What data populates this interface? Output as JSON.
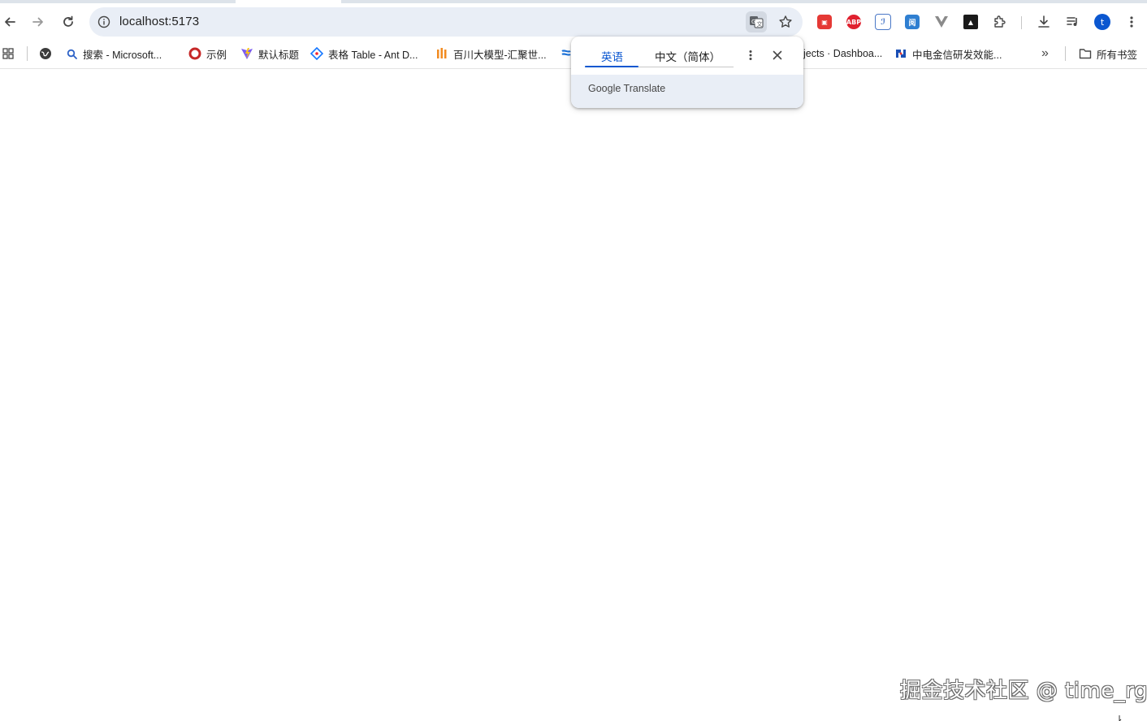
{
  "toolbar": {
    "url": "localhost:5173",
    "extensions": [
      "gift-extension",
      "adblock-plus-extension",
      "dictionary-extension",
      "translate-helper-extension",
      "vue-devtools-extension",
      "dark-extension",
      "extensions-puzzle"
    ],
    "abp_label": "ABP",
    "avatar_letter": "t"
  },
  "bookmarks": {
    "items": [
      {
        "label": "搜索 - Microsoft..."
      },
      {
        "label": "示例"
      },
      {
        "label": "默认标题"
      },
      {
        "label": "表格 Table - Ant D..."
      },
      {
        "label": "百川大模型-汇聚世..."
      },
      {
        "label": "jects · Dashboa..."
      },
      {
        "label": "中电金信研发效能..."
      }
    ],
    "overflow_label": "»",
    "all_bookmarks": "所有书签"
  },
  "translate_popup": {
    "tab_source": "英语",
    "tab_target": "中文（简体）",
    "brand": "Google Translate"
  },
  "watermark": "掘金技术社区 @ time_rg",
  "colors": {
    "accent": "#0b57d0",
    "omnibox_bg": "#e9eef6",
    "abp_red": "#e0212f"
  }
}
